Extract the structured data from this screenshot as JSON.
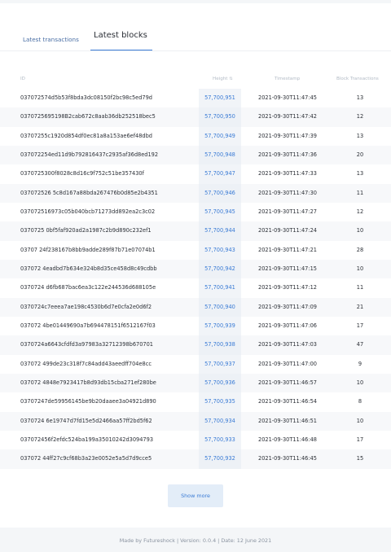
{
  "tabs": {
    "latest_transactions": "Latest transactions",
    "latest_blocks": "Latest blocks"
  },
  "table": {
    "headers": {
      "id": "ID",
      "height": "Height",
      "timestamp": "Timestamp",
      "block_transactions": "Block Transactions"
    },
    "rows": [
      {
        "id": "037072574d5b53f8bda3dc08150f2bc98c5ed79d",
        "height": "57,700,951",
        "timestamp": "2021-09-30T11:47:45",
        "txs": "13"
      },
      {
        "id": "0370725695198B2cab672c8aab36db252518bec5",
        "height": "57,700,950",
        "timestamp": "2021-09-30T11:47:42",
        "txs": "12"
      },
      {
        "id": "03707255c1920d854df0ec81a8a153ae6ef48dbd",
        "height": "57,700,949",
        "timestamp": "2021-09-30T11:47:39",
        "txs": "13"
      },
      {
        "id": "037072254ed11d9b792816437c2935af36d8ed192",
        "height": "57,700,948",
        "timestamp": "2021-09-30T11:47:36",
        "txs": "20"
      },
      {
        "id": "0370725300f8028c8d16c9f752c51be357430f",
        "height": "57,700,947",
        "timestamp": "2021-09-30T11:47:33",
        "txs": "13"
      },
      {
        "id": "037072526 5c8d167a88bda267476b0d85e2b4351",
        "height": "57,700,946",
        "timestamp": "2021-09-30T11:47:30",
        "txs": "11"
      },
      {
        "id": "037072516973c05b040bcb71273dd892ea2c3c02",
        "height": "57,700,945",
        "timestamp": "2021-09-30T11:47:27",
        "txs": "12"
      },
      {
        "id": "0370725 0bf5faf920ad2a1987c2b9d890c232ef1",
        "height": "57,700,944",
        "timestamp": "2021-09-30T11:47:24",
        "txs": "10"
      },
      {
        "id": "03707 24f238167b8bb9adde289f87b71e07074b1",
        "height": "57,700,943",
        "timestamp": "2021-09-30T11:47:21",
        "txs": "28"
      },
      {
        "id": "037072 4eadbd7b634e324b8d35ce458d8c49cdbb",
        "height": "57,700,942",
        "timestamp": "2021-09-30T11:47:15",
        "txs": "10"
      },
      {
        "id": "0370724 d6fb687bac6ea3c122e244536d688105e",
        "height": "57,700,941",
        "timestamp": "2021-09-30T11:47:12",
        "txs": "11"
      },
      {
        "id": "0370724c7eeea7ae198c4530b6d7e0cfa2e0d6f2",
        "height": "57,700,940",
        "timestamp": "2021-09-30T11:47:09",
        "txs": "21"
      },
      {
        "id": "037072 4be01449690a7b694478151f6512167f03",
        "height": "57,700,939",
        "timestamp": "2021-09-30T11:47:06",
        "txs": "17"
      },
      {
        "id": "0370724a6643cfdfd3a97983a32712398b670701",
        "height": "57,700,938",
        "timestamp": "2021-09-30T11:47:03",
        "txs": "47"
      },
      {
        "id": "037072 499de23c318f7c84add43aeedff704e8cc",
        "height": "57,700,937",
        "timestamp": "2021-09-30T11:47:00",
        "txs": "9"
      },
      {
        "id": "037072 4848e7923417b8d93db15cba271ef280be",
        "height": "57,700,936",
        "timestamp": "2021-09-30T11:46:57",
        "txs": "10"
      },
      {
        "id": "03707247de59956145be9b20daaee3a04921d890",
        "height": "57,700,935",
        "timestamp": "2021-09-30T11:46:54",
        "txs": "8"
      },
      {
        "id": "0370724 6e19747d7fd15e5d2466aa57ff2bd5f62",
        "height": "57,700,934",
        "timestamp": "2021-09-30T11:46:51",
        "txs": "10"
      },
      {
        "id": "037072456f2efdc524ba199a35010242d3094793",
        "height": "57,700,933",
        "timestamp": "2021-09-30T11:46:48",
        "txs": "17"
      },
      {
        "id": "037072 44ff27c9cf68b3a23e0052e5a5d7d9cce5",
        "height": "57,700,932",
        "timestamp": "2021-09-30T11:46:45",
        "txs": "15"
      }
    ]
  },
  "show_more": "Show more",
  "footer": "Made by Futureshock | Version: 0.0.4 | Date: 12 June 2021",
  "colors": {
    "accent": "#3a7bd5",
    "background": "#f4f6f8"
  },
  "icons": {
    "sort": "sort-arrows-icon"
  }
}
